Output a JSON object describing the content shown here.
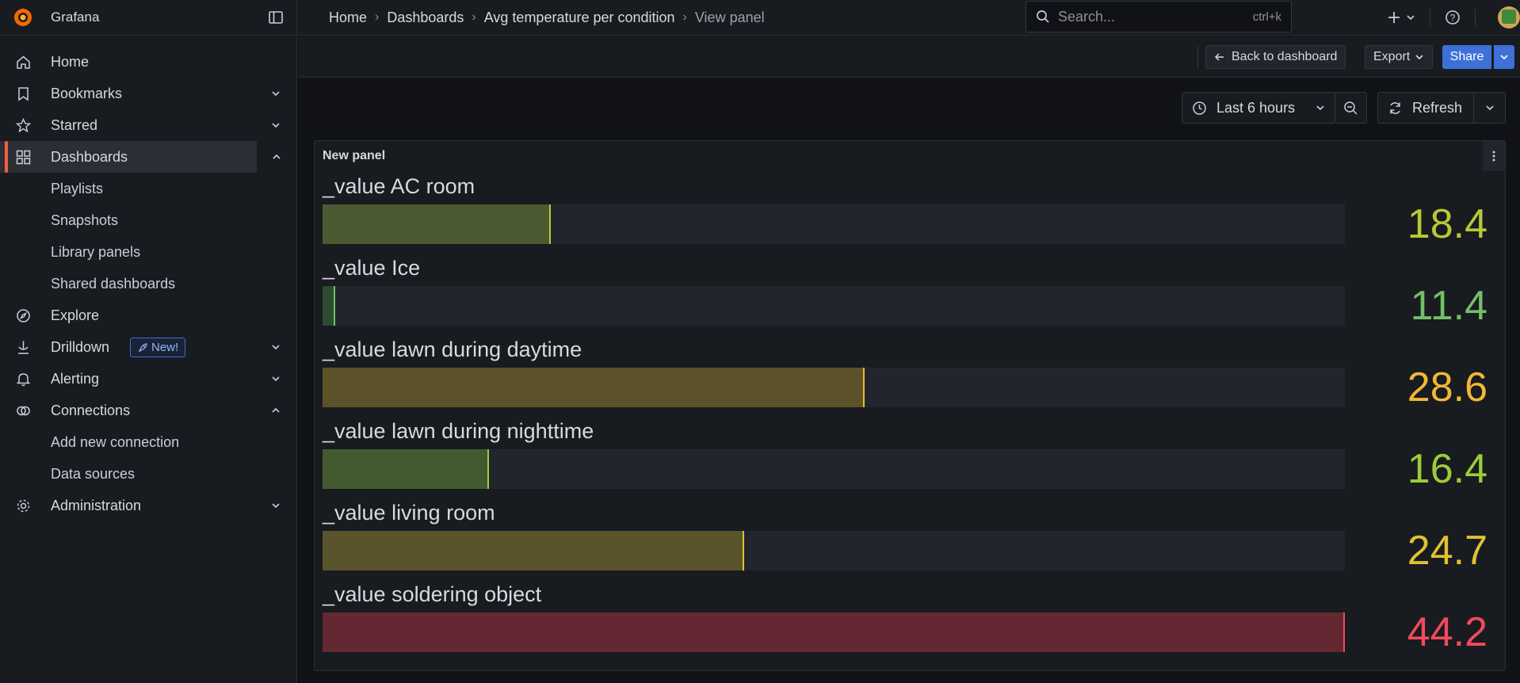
{
  "app": {
    "name": "Grafana"
  },
  "breadcrumb": [
    {
      "label": "Home"
    },
    {
      "label": "Dashboards"
    },
    {
      "label": "Avg temperature per condition"
    },
    {
      "label": "View panel"
    }
  ],
  "search": {
    "placeholder": "Search...",
    "shortcut": "ctrl+k"
  },
  "sidebar": {
    "items": [
      {
        "label": "Home",
        "icon": "home-icon"
      },
      {
        "label": "Bookmarks",
        "icon": "bookmark-icon"
      },
      {
        "label": "Starred",
        "icon": "star-icon"
      },
      {
        "label": "Dashboards",
        "icon": "dashboards-icon"
      },
      {
        "label": "Playlists"
      },
      {
        "label": "Snapshots"
      },
      {
        "label": "Library panels"
      },
      {
        "label": "Shared dashboards"
      },
      {
        "label": "Explore",
        "icon": "compass-icon"
      },
      {
        "label": "Drilldown",
        "icon": "drilldown-icon",
        "badge": "New!"
      },
      {
        "label": "Alerting",
        "icon": "bell-icon"
      },
      {
        "label": "Connections",
        "icon": "connections-icon"
      },
      {
        "label": "Add new connection"
      },
      {
        "label": "Data sources"
      },
      {
        "label": "Administration",
        "icon": "gear-icon"
      }
    ]
  },
  "toolbar": {
    "back_label": "Back to dashboard",
    "export_label": "Export",
    "share_label": "Share",
    "time_range": "Last 6 hours",
    "refresh_label": "Refresh"
  },
  "panel": {
    "title": "New panel",
    "rows": [
      {
        "label": "_value AC room",
        "value": "18.4",
        "num": 18.4,
        "color": "#b8c934",
        "fill": "#4a5a30"
      },
      {
        "label": "_value Ice",
        "value": "11.4",
        "num": 11.4,
        "color": "#73bf69",
        "fill": "#2e4a30"
      },
      {
        "label": "_value lawn during daytime",
        "value": "28.6",
        "num": 28.6,
        "color": "#f2b735",
        "fill": "#5c522a"
      },
      {
        "label": "_value lawn during nighttime",
        "value": "16.4",
        "num": 16.4,
        "color": "#9ccc3a",
        "fill": "#435a30"
      },
      {
        "label": "_value living room",
        "value": "24.7",
        "num": 24.7,
        "color": "#e0c232",
        "fill": "#5a542c"
      },
      {
        "label": "_value soldering object",
        "value": "44.2",
        "num": 44.2,
        "color": "#f2495c",
        "fill": "#642833"
      }
    ]
  }
}
